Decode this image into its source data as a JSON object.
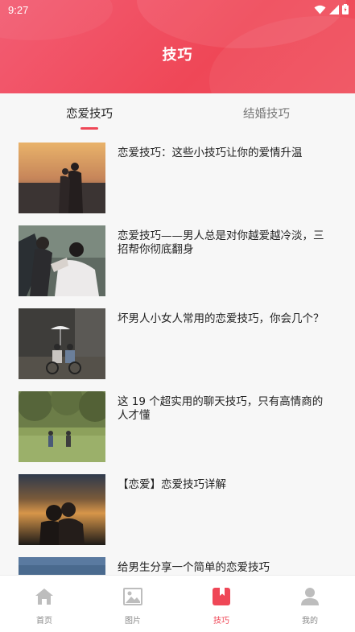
{
  "status_bar": {
    "time": "9:27"
  },
  "header": {
    "title": "技巧"
  },
  "tabs": [
    {
      "label": "恋爱技巧",
      "active": true
    },
    {
      "label": "结婚技巧",
      "active": false
    }
  ],
  "articles": [
    {
      "title": "恋爱技巧：这些小技巧让你的爱情升温"
    },
    {
      "title": "恋爱技巧——男人总是对你越爱越冷淡，三招帮你彻底翻身"
    },
    {
      "title": "坏男人小女人常用的恋爱技巧，你会几个？"
    },
    {
      "title": "这 19 个超实用的聊天技巧，只有高情商的人才懂"
    },
    {
      "title": "【恋爱】恋爱技巧详解"
    },
    {
      "title": "给男生分享一个简单的恋爱技巧"
    }
  ],
  "bottom_nav": [
    {
      "label": "首页",
      "icon": "home-icon",
      "active": false
    },
    {
      "label": "图片",
      "icon": "image-icon",
      "active": false
    },
    {
      "label": "技巧",
      "icon": "bookmark-icon",
      "active": true
    },
    {
      "label": "我的",
      "icon": "user-icon",
      "active": false
    }
  ],
  "colors": {
    "accent": "#ef4757",
    "inactive": "#bdbdbd"
  }
}
